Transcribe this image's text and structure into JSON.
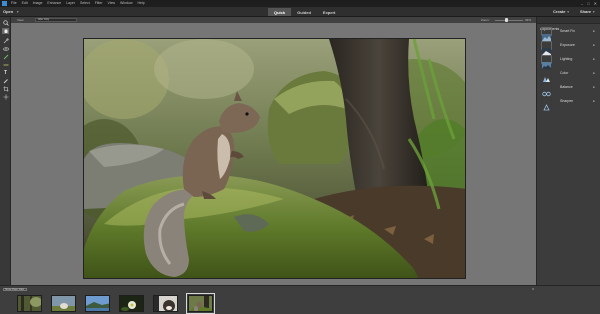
{
  "menu": {
    "items": [
      "File",
      "Edit",
      "Image",
      "Enhance",
      "Layer",
      "Select",
      "Filter",
      "View",
      "Window",
      "Help"
    ],
    "window_controls": [
      "–",
      "□",
      "✕"
    ]
  },
  "topbar": {
    "open_label": "Open",
    "modes": [
      {
        "label": "Quick",
        "active": true
      },
      {
        "label": "Guided",
        "active": false
      },
      {
        "label": "Expert",
        "active": false
      }
    ],
    "create_label": "Create",
    "share_label": "Share"
  },
  "options": {
    "view_label": "View:",
    "view_value": "After Only",
    "zoom_label": "Zoom:",
    "zoom_value": "33%",
    "zoom_level": 0.4
  },
  "tools": [
    "zoom-icon",
    "hand-icon",
    "quick-selection-icon",
    "eye-icon",
    "whiten-teeth-icon",
    "straighten-icon",
    "type-icon",
    "spot-healing-icon",
    "crop-icon",
    "move-icon"
  ],
  "panel": {
    "title": "Adjustments",
    "items": [
      {
        "label": "Smart Fix",
        "icon": "smart-fix-icon"
      },
      {
        "label": "Exposure",
        "icon": "exposure-icon"
      },
      {
        "label": "Lighting",
        "icon": "lighting-icon"
      },
      {
        "label": "Color",
        "icon": "color-icon"
      },
      {
        "label": "Balance",
        "icon": "balance-icon"
      },
      {
        "label": "Sharpen",
        "icon": "sharpen-icon"
      }
    ]
  },
  "bin": {
    "header_label": "Show Open Files",
    "menu_icon": "≡",
    "thumbnails": [
      {
        "name": "forest-thumbnail",
        "selected": false
      },
      {
        "name": "dog-field-thumbnail",
        "selected": false
      },
      {
        "name": "lake-thumbnail",
        "selected": false
      },
      {
        "name": "flower-thumbnail",
        "selected": false
      },
      {
        "name": "dog-portrait-thumbnail",
        "selected": false
      },
      {
        "name": "squirrel-thumbnail",
        "selected": true
      }
    ]
  },
  "colors": {
    "menu_bg": "#1e1e1e",
    "canvas_bg": "#767676",
    "panel_bg": "#3c3c3c",
    "active_mode": "#545454"
  }
}
